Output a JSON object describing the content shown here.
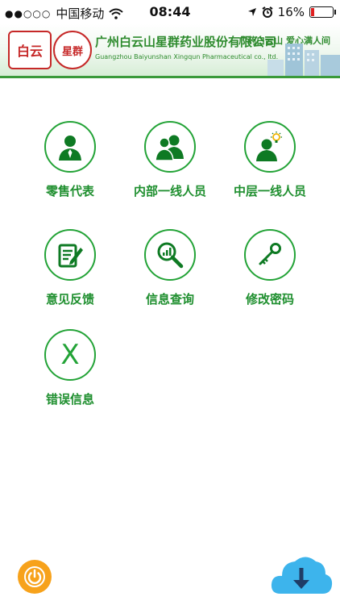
{
  "status_bar": {
    "signal_dots": "●●○○○",
    "carrier": "中国移动",
    "time": "08:44",
    "battery_percent": "16%",
    "battery_level": 0.16
  },
  "banner": {
    "logo_text": "白云",
    "seal_text": "星群",
    "company_name_cn": "广州白云山星群药业股份有限公司",
    "company_name_en": "Guangzhou Baiyunshan Xingqun Pharmaceutical co., ltd.",
    "slogan": "广药白云山 爱心满人间",
    "brand_green": "#2e8b2e",
    "brand_red": "#c62828"
  },
  "menu": {
    "accent_color": "#23a337",
    "items": [
      {
        "label": "零售代表",
        "icon": "sales-rep-icon"
      },
      {
        "label": "内部一线人员",
        "icon": "team-icon"
      },
      {
        "label": "中层一线人员",
        "icon": "manager-idea-icon"
      },
      {
        "label": "意见反馈",
        "icon": "feedback-icon"
      },
      {
        "label": "信息查询",
        "icon": "search-chart-icon"
      },
      {
        "label": "修改密码",
        "icon": "key-icon"
      },
      {
        "label": "错误信息",
        "icon": "x-icon",
        "glyph": "X"
      }
    ]
  },
  "footer": {
    "power_icon": "power-icon",
    "download_icon": "cloud-download-icon",
    "power_color": "#f7a21b",
    "download_color": "#3db4ec"
  }
}
